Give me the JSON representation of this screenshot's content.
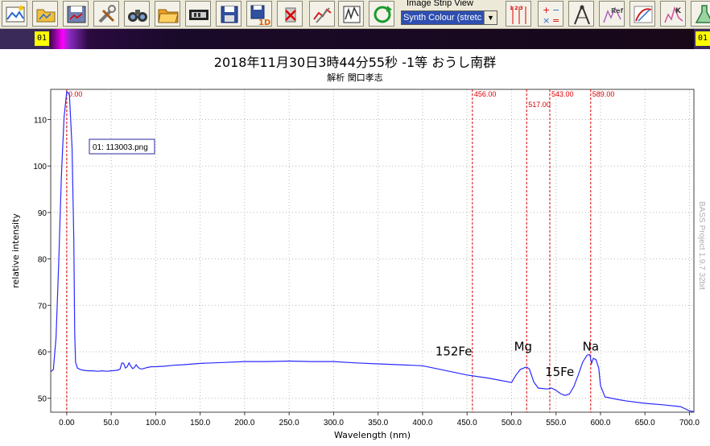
{
  "toolbar": {
    "buttons": [
      {
        "name": "open-image-icon",
        "x": 2
      },
      {
        "name": "open-folder-icon",
        "x": 40
      },
      {
        "name": "save-image-icon",
        "x": 78
      },
      {
        "name": "tools-icon",
        "x": 116
      },
      {
        "name": "binoculars-icon",
        "x": 154
      },
      {
        "name": "folder-open-icon",
        "x": 192
      },
      {
        "name": "film-strip-icon",
        "x": 230
      },
      {
        "name": "save-disk-icon",
        "x": 268
      },
      {
        "name": "save-1d-icon",
        "x": 306
      },
      {
        "name": "delete-icon",
        "x": 344
      },
      {
        "name": "calibrate-icon",
        "x": 384
      },
      {
        "name": "crop-icon",
        "x": 420
      },
      {
        "name": "refresh-icon",
        "x": 458
      },
      {
        "name": "wavelength-icon",
        "x": 628
      },
      {
        "name": "calculator-icon",
        "x": 668
      },
      {
        "name": "compass-icon",
        "x": 706
      },
      {
        "name": "reference-icon",
        "x": 744
      },
      {
        "name": "response-icon",
        "x": 782
      },
      {
        "name": "kelvin-icon",
        "x": 820
      },
      {
        "name": "flask-icon",
        "x": 858
      }
    ],
    "save_1d_text": "1D",
    "reference_text": "Ref",
    "kelvin_text": "K",
    "wavelength_text": "1 2 3",
    "image_strip_label": "Image Strip View",
    "image_strip_select": "Synth Colour (stretc",
    "image_strip_arrow": "▼"
  },
  "strip": {
    "left_badge": "01",
    "right_badge": "01"
  },
  "chart_data": {
    "type": "line",
    "title": "2018年11月30日3時44分55秒  -1等  おうし南群",
    "subtitle": "解析  関口孝志",
    "xlabel": "Wavelength (nm)",
    "ylabel": "relative intensity",
    "xlim": [
      -18,
      705
    ],
    "ylim": [
      47,
      116.5
    ],
    "xticks": [
      "0.00",
      "50.0",
      "100.0",
      "150.0",
      "200.0",
      "250.0",
      "300.0",
      "350.0",
      "400.0",
      "450.0",
      "500.0",
      "550.0",
      "600.0",
      "650.0",
      "700.0"
    ],
    "xtick_values": [
      0,
      50,
      100,
      150,
      200,
      250,
      300,
      350,
      400,
      450,
      500,
      550,
      600,
      650,
      700
    ],
    "yticks": [
      50,
      60,
      70,
      80,
      90,
      100,
      110
    ],
    "grid": true,
    "legend_box": "01: 113003.png",
    "series": [
      {
        "color": "#2a2aff",
        "x": [
          -18,
          -15,
          -12,
          -9,
          -6,
          -3,
          0,
          3,
          6,
          8,
          9,
          10,
          12,
          15,
          20,
          25,
          30,
          35,
          40,
          45,
          50,
          55,
          58,
          60,
          62,
          64,
          66,
          68,
          70,
          72,
          74,
          76,
          78,
          80,
          82,
          85,
          90,
          95,
          100,
          110,
          120,
          130,
          150,
          175,
          200,
          225,
          250,
          275,
          300,
          325,
          350,
          375,
          400,
          425,
          450,
          475,
          500,
          505,
          510,
          515,
          517,
          520,
          525,
          530,
          535,
          540,
          545,
          550,
          555,
          560,
          565,
          570,
          575,
          580,
          585,
          588,
          590,
          592,
          595,
          598,
          600,
          605,
          610,
          620,
          630,
          650,
          670,
          690,
          700,
          705
        ],
        "y": [
          55.7,
          56.2,
          63,
          79,
          98,
          110.5,
          116,
          115.5,
          104,
          84,
          64,
          57.7,
          56.5,
          56.2,
          56,
          55.9,
          55.9,
          55.8,
          55.9,
          55.8,
          55.9,
          56,
          56.1,
          56.3,
          57.6,
          57.5,
          56.5,
          56.8,
          57.6,
          56.9,
          56.4,
          56.6,
          57.2,
          56.7,
          56.4,
          56.3,
          56.6,
          56.8,
          56.8,
          56.9,
          57.1,
          57.2,
          57.5,
          57.7,
          57.9,
          57.9,
          58,
          57.9,
          57.9,
          57.6,
          57.4,
          57.2,
          57,
          56,
          55,
          54.3,
          53.4,
          55,
          56.2,
          56.6,
          56.7,
          56.3,
          53.5,
          52.2,
          52.1,
          52,
          52.2,
          51.7,
          51,
          50.6,
          50.9,
          52.5,
          55,
          57.8,
          59.3,
          59.4,
          57.5,
          58.6,
          58.3,
          56.5,
          52.7,
          50.3,
          50.1,
          49.7,
          49.4,
          48.9,
          48.6,
          48.2,
          47.3,
          47.1
        ]
      }
    ],
    "markers": [
      {
        "x": 0,
        "label": "0.00"
      },
      {
        "x": 456,
        "label": "456.00"
      },
      {
        "x": 517,
        "label": "517.00"
      },
      {
        "x": 543,
        "label": "543.00"
      },
      {
        "x": 589,
        "label": "589.00"
      }
    ],
    "annotations": [
      {
        "text": "152Fe",
        "x": 435,
        "y": 59.2
      },
      {
        "text": "Mg",
        "x": 513,
        "y": 60.3
      },
      {
        "text": "15Fe",
        "x": 554,
        "y": 54.8
      },
      {
        "text": "Na",
        "x": 589,
        "y": 60.3
      }
    ]
  },
  "watermark": "BASS Project 1.9.7  32bit",
  "colors": {
    "plot_line": "#2a2aff",
    "marker": "#dd0000",
    "grid": "#b8b8b8"
  }
}
